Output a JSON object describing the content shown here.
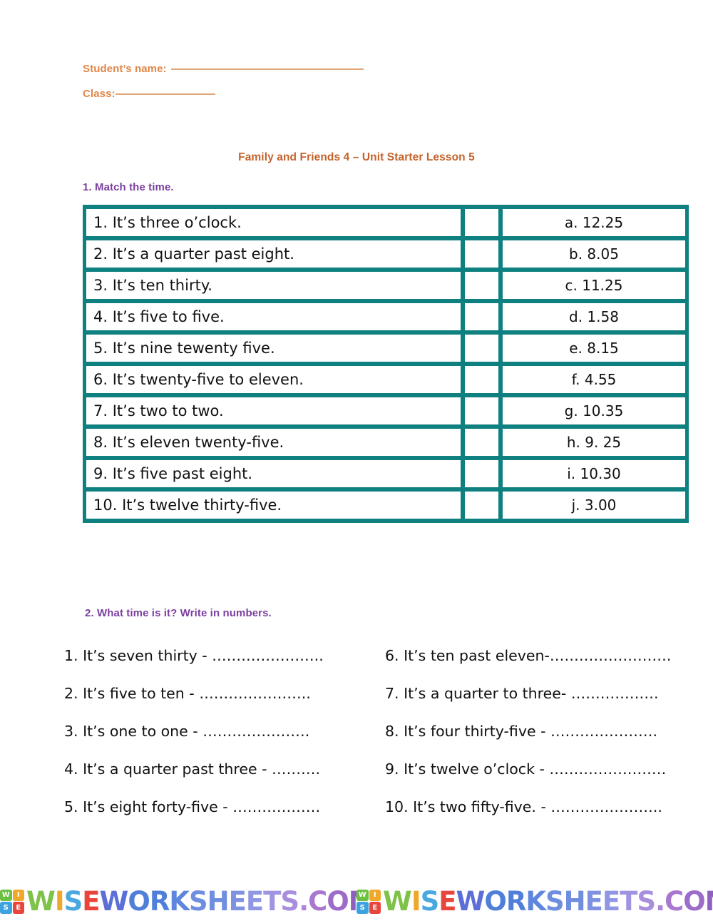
{
  "header": {
    "student_name_label": "Student’s name:",
    "class_label": "Class:",
    "title": "Family and Friends 4 – Unit Starter Lesson 5"
  },
  "colors": {
    "teal_border": "#0e8080",
    "orange_field": "#e0874a",
    "title_orange": "#c4622a",
    "heading_purple": "#7b3fa0"
  },
  "section1": {
    "heading": "1. Match the time.",
    "prompts": [
      "1. It’s three o’clock.",
      "2. It’s a quarter past eight.",
      "3. It’s ten thirty.",
      "4. It’s five to five.",
      "5. It’s nine tewenty five.",
      "6. It’s twenty-five to eleven.",
      "7. It’s two to two.",
      "8. It’s eleven twenty-five.",
      "9. It’s five past eight.",
      "10. It’s twelve thirty-five."
    ],
    "answer_boxes": [
      "",
      "",
      "",
      "",
      "",
      "",
      "",
      "",
      "",
      ""
    ],
    "options": [
      "a. 12.25",
      "b. 8.05",
      "c. 11.25",
      "d. 1.58",
      "e. 8.15",
      "f. 4.55",
      "g. 10.35",
      "h. 9. 25",
      "i. 10.30",
      "j. 3.00"
    ]
  },
  "section2": {
    "heading": "2. What time is it? Write in numbers.",
    "left_items": [
      "1. It’s seven thirty -  …………………..",
      "2. It’s five to ten -  …………………..",
      "3. It’s one to one -  ………………….",
      "4. It’s a quarter past three -  ……….",
      "5. It’s eight forty-five -  ………………"
    ],
    "right_items": [
      "6. It’s ten past eleven-…………………….",
      "7. It’s a quarter to three-  ………………",
      "8. It’s four thirty-five -  ………………….",
      "9. It’s twelve o’clock -  ……………………",
      "10. It’s two fifty-five. -  ………………….."
    ]
  },
  "footer": {
    "watermark_text": "WISEWORKSHEETS.COM",
    "logo_letters": [
      "W",
      "I",
      "S",
      "E"
    ],
    "repetitions": 2
  }
}
